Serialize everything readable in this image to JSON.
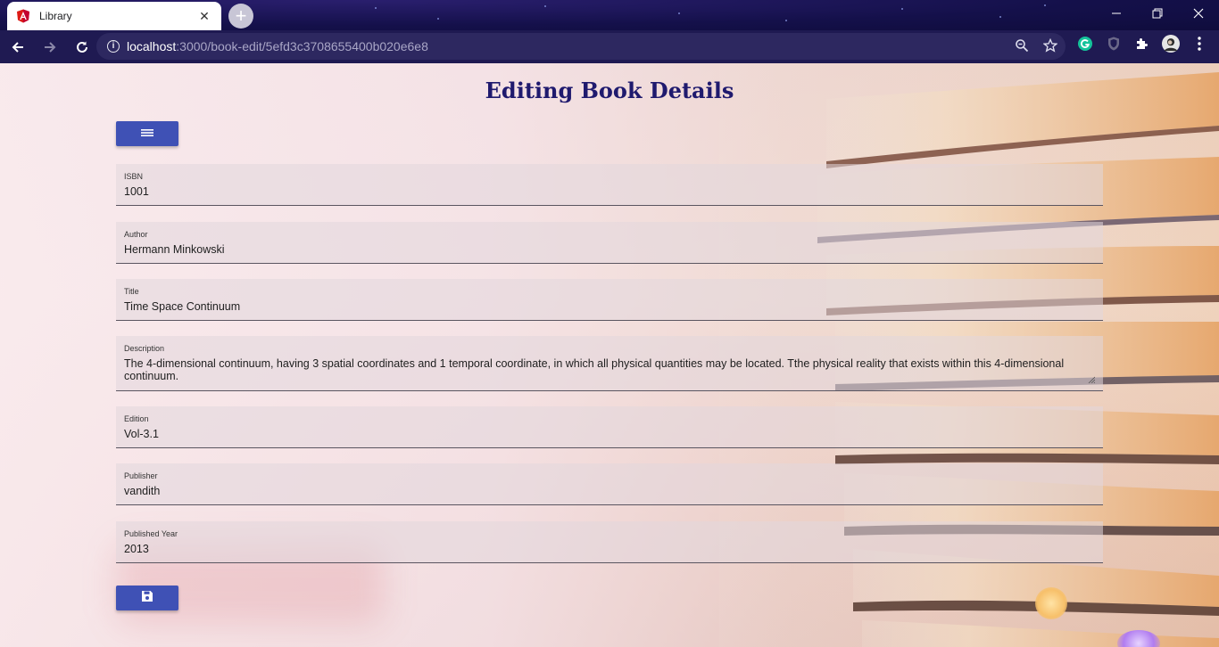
{
  "browser": {
    "tab_title": "Library",
    "url_host": "localhost",
    "url_path": ":3000/book-edit/5efd3c3708655400b020e6e8"
  },
  "page": {
    "title": "Editing Book Details"
  },
  "form": {
    "fields": [
      {
        "label": "ISBN",
        "value": "1001"
      },
      {
        "label": "Author",
        "value": "Hermann Minkowski"
      },
      {
        "label": "Title",
        "value": "Time Space Continuum"
      },
      {
        "label": "Description",
        "value": "The 4-dimensional continuum, having 3 spatial coordinates and 1 temporal coordinate, in which all physical quantities may be located. Tthe physical reality that exists within this 4-dimensional continuum."
      },
      {
        "label": "Edition",
        "value": "Vol-3.1"
      },
      {
        "label": "Publisher",
        "value": "vandith"
      },
      {
        "label": "Published Year",
        "value": "2013"
      }
    ]
  },
  "icons": {
    "list_button": "list-icon",
    "save_button": "save-icon"
  },
  "colors": {
    "primary": "#3f51b5",
    "title": "#1f1a6e",
    "chrome": "#1f1a52"
  }
}
